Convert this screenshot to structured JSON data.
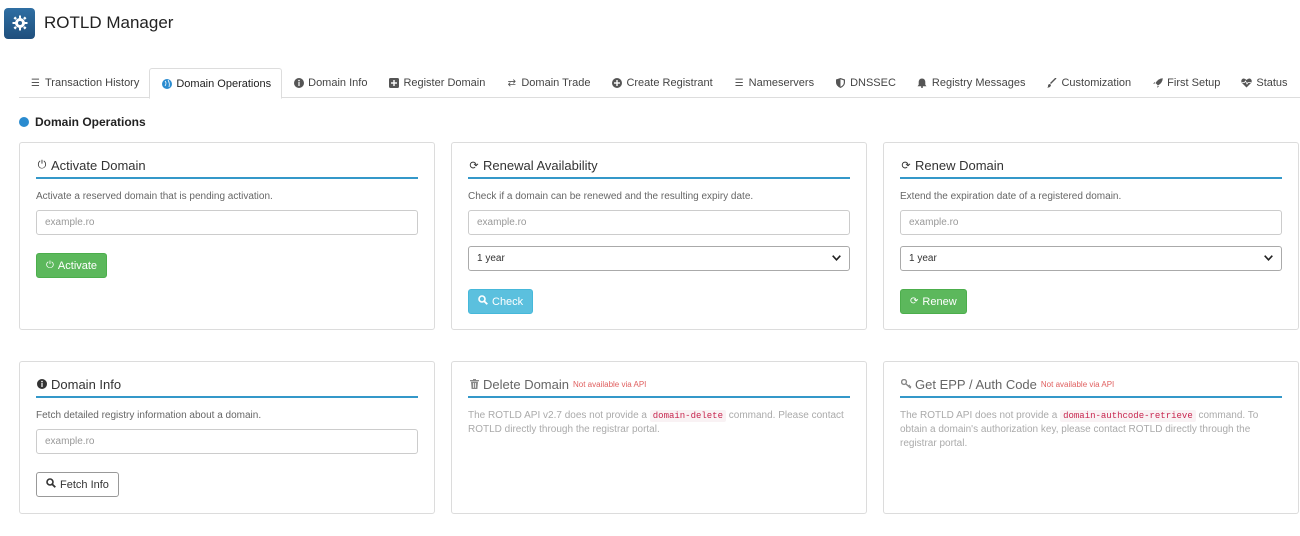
{
  "app": {
    "title": "ROTLD Manager",
    "logo_icon": "gear-icon",
    "logo_color": "#2f6fa3"
  },
  "tabs": [
    {
      "label": "Transaction History",
      "icon": "list-icon",
      "active": false
    },
    {
      "label": "Domain Operations",
      "icon": "globe-icon",
      "active": true
    },
    {
      "label": "Domain Info",
      "icon": "info-icon",
      "active": false
    },
    {
      "label": "Register Domain",
      "icon": "plus-square-icon",
      "active": false
    },
    {
      "label": "Domain Trade",
      "icon": "exchange-icon",
      "active": false
    },
    {
      "label": "Create Registrant",
      "icon": "plus-circle-icon",
      "active": false
    },
    {
      "label": "Nameservers",
      "icon": "server-icon",
      "active": false
    },
    {
      "label": "DNSSEC",
      "icon": "shield-icon",
      "active": false
    },
    {
      "label": "Registry Messages",
      "icon": "bell-icon",
      "active": false
    },
    {
      "label": "Customization",
      "icon": "brush-icon",
      "active": false
    },
    {
      "label": "First Setup",
      "icon": "rocket-icon",
      "active": false
    },
    {
      "label": "Status",
      "icon": "heartbeat-icon",
      "active": false
    }
  ],
  "section": {
    "title": "Domain Operations"
  },
  "cards": {
    "activate": {
      "title": "Activate Domain",
      "description": "Activate a reserved domain that is pending activation.",
      "placeholder": "example.ro",
      "button": "Activate"
    },
    "renewal": {
      "title": "Renewal Availability",
      "description": "Check if a domain can be renewed and the resulting expiry date.",
      "placeholder": "example.ro",
      "period": "1 year",
      "button": "Check"
    },
    "renew": {
      "title": "Renew Domain",
      "description": "Extend the expiration date of a registered domain.",
      "placeholder": "example.ro",
      "period": "1 year",
      "button": "Renew"
    },
    "info": {
      "title": "Domain Info",
      "description": "Fetch detailed registry information about a domain.",
      "placeholder": "example.ro",
      "button": "Fetch Info"
    },
    "delete": {
      "title": "Delete Domain",
      "badge": "Not available via API",
      "desc_before": "The ROTLD API v2.7 does not provide a ",
      "code": "domain-delete",
      "desc_after": " command. Please contact ROTLD directly through the registrar portal."
    },
    "epp": {
      "title": "Get EPP / Auth Code",
      "badge": "Not available via API",
      "desc_before": "The ROTLD API does not provide a ",
      "code": "domain-authcode-retrieve",
      "desc_after": " command. To obtain a domain's authorization key, please contact ROTLD directly through the registrar portal."
    }
  },
  "colors": {
    "accent": "#3498c9",
    "success": "#5cb85c",
    "info": "#5bc0de",
    "warning_text": "#e06060"
  }
}
